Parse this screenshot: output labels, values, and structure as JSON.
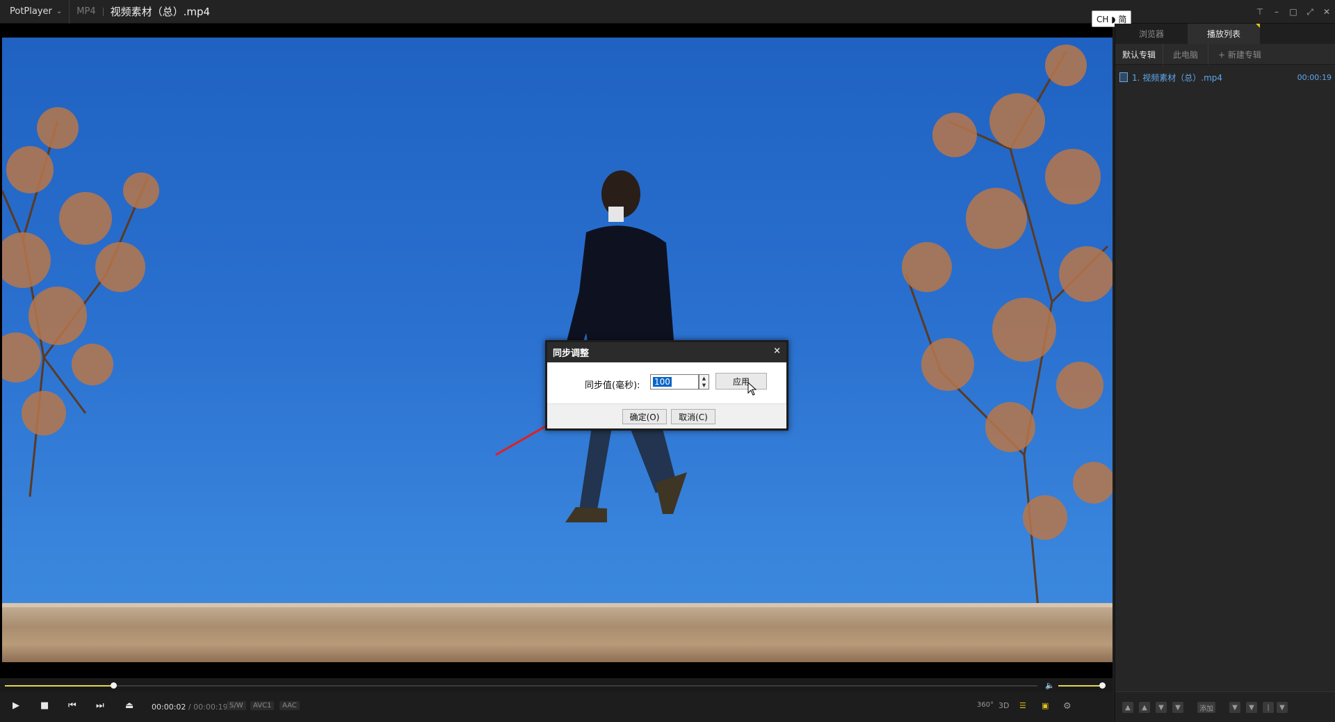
{
  "titlebar": {
    "app_name": "PotPlayer",
    "format": "MP4",
    "file_title": "视频素材（总）.mp4",
    "controls": [
      "pin-icon",
      "minimize-icon",
      "maximize-icon",
      "fullscreen-icon",
      "close-icon"
    ]
  },
  "dialog": {
    "title": "同步调整",
    "close_glyph": "×",
    "label": "同步值(毫秒):",
    "value": "100",
    "apply_label": "应用",
    "ok_label": "确定(O)",
    "cancel_label": "取消(C)"
  },
  "seek": {
    "position_fraction": 0.105,
    "volume_fraction": 0.96
  },
  "controls": {
    "current_time": "00:00:02",
    "separator": "/",
    "total_time": "00:00:19",
    "chips": [
      "S/W",
      "AVC1",
      "AAC"
    ],
    "right_labels": [
      "360°",
      "3D"
    ],
    "ime_text": "CH ◗ 简"
  },
  "panel": {
    "tabs": [
      "浏览器",
      "播放列表"
    ],
    "active_tab": 1,
    "subtabs": [
      "默认专辑",
      "此电脑",
      "+ 新建专辑"
    ],
    "items": [
      {
        "label": "1. 视频素材（总）.mp4",
        "duration": "00:00:19"
      }
    ],
    "footer": {
      "add_label": "添加"
    }
  },
  "colors": {
    "accent": "#e6d84a",
    "playlist_link": "#5fa8ee",
    "annotation_arrow": "#e02020"
  }
}
